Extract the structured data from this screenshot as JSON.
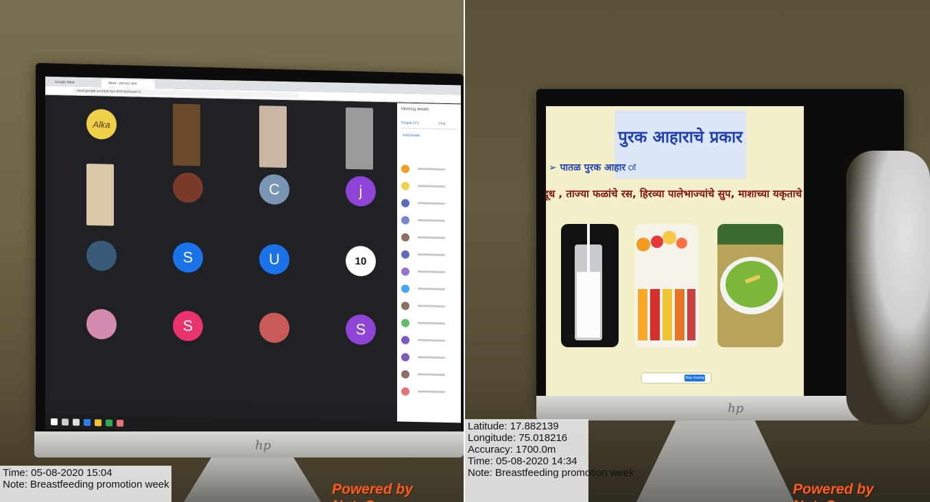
{
  "left_photo": {
    "browser": {
      "tab1_label": "Google Meet",
      "tab2_label": "Meet - jnb-hyz-dmt",
      "url": "meet.google.com/jnb-hyz-dmt?authuser=1"
    },
    "participant_tiles": [
      {
        "label": "Alka",
        "color": "#f2d14a",
        "kind": "avatar"
      },
      {
        "label": "",
        "color": "#6a4a2a",
        "kind": "video"
      },
      {
        "label": "",
        "color": "#c9b7a3",
        "kind": "video"
      },
      {
        "label": "",
        "color": "#9a9a9a",
        "kind": "video"
      },
      {
        "label": "",
        "color": "#d9c8a8",
        "kind": "video"
      },
      {
        "label": "",
        "color": "#7a3a2a",
        "kind": "avatar"
      },
      {
        "label": "C",
        "color": "#7895b3",
        "kind": "letter"
      },
      {
        "label": "j",
        "color": "#8e44d6",
        "kind": "letter"
      },
      {
        "label": "",
        "color": "#3a5a7a",
        "kind": "avatar"
      },
      {
        "label": "S",
        "color": "#1a73e8",
        "kind": "letter"
      },
      {
        "label": "U",
        "color": "#1a73e8",
        "kind": "letter"
      },
      {
        "label": "10",
        "color": "#ffffff",
        "kind": "avatar"
      },
      {
        "label": "",
        "color": "#d58bb0",
        "kind": "avatar"
      },
      {
        "label": "S",
        "color": "#e8336d",
        "kind": "letter"
      },
      {
        "label": "",
        "color": "#c85a5a",
        "kind": "avatar"
      },
      {
        "label": "S",
        "color": "#8e44d6",
        "kind": "letter"
      }
    ],
    "side_panel": {
      "title": "Meeting details",
      "tab_people": "People (17)",
      "tab_chat": "Chat",
      "add_people": "Add people"
    },
    "overlay": {
      "time": "Time: 05-08-2020 15:04",
      "note": "Note: Breastfeeding promotion week"
    },
    "powered_by": "Powered by NoteCam",
    "monitor_logo": "hp"
  },
  "right_photo": {
    "slide": {
      "title": "पुरक आहाराचे प्रकार",
      "subtitle": "➢ पातळ पुरक आहार ः",
      "line": "दूध , ताज्या फळांचे रस, हिरव्या पालेभाज्यांचे सुप, माशाच्या यकृताचे तेल"
    },
    "share_bar": {
      "stop_label": "Stop sharing"
    },
    "overlay": {
      "latitude": "Latitude: 17.882139",
      "longitude": "Longitude: 75.018216",
      "accuracy": "Accuracy: 1700.0m",
      "time": "Time: 05-08-2020 14:34",
      "note": "Note: Breastfeeding promotion week"
    },
    "powered_by": "Powered by NoteCam",
    "monitor_logo": "hp"
  }
}
